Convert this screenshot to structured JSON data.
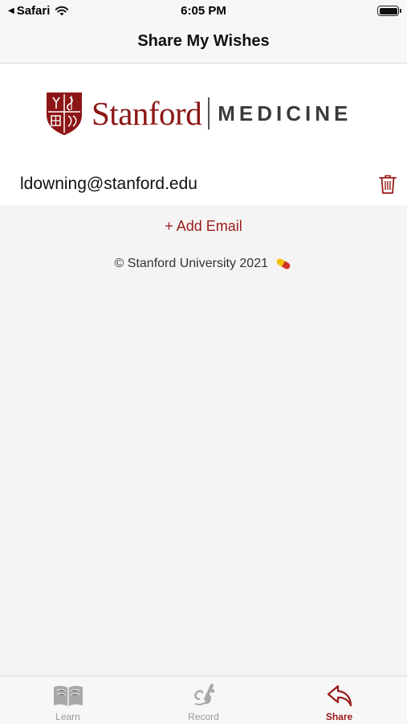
{
  "status_bar": {
    "back_app": "Safari",
    "time": "6:05 PM"
  },
  "nav": {
    "title": "Share My Wishes"
  },
  "logo": {
    "brand": "Stanford",
    "sub": "MEDICINE"
  },
  "emails": [
    {
      "address": "ldowning@stanford.edu",
      "action_icon": "trash-icon"
    }
  ],
  "add_email_label": "+ Add Email",
  "copyright": "© Stanford University 2021",
  "tabs": [
    {
      "label": "Learn",
      "icon": "book-icon",
      "active": false
    },
    {
      "label": "Record",
      "icon": "writing-hand-icon",
      "active": false
    },
    {
      "label": "Share",
      "icon": "share-reply-icon",
      "active": true
    }
  ],
  "colors": {
    "accent": "#9b1b1b",
    "brand_red": "#8c1515",
    "tab_inactive": "#9a9a9a",
    "background": "#f4f4f4"
  }
}
